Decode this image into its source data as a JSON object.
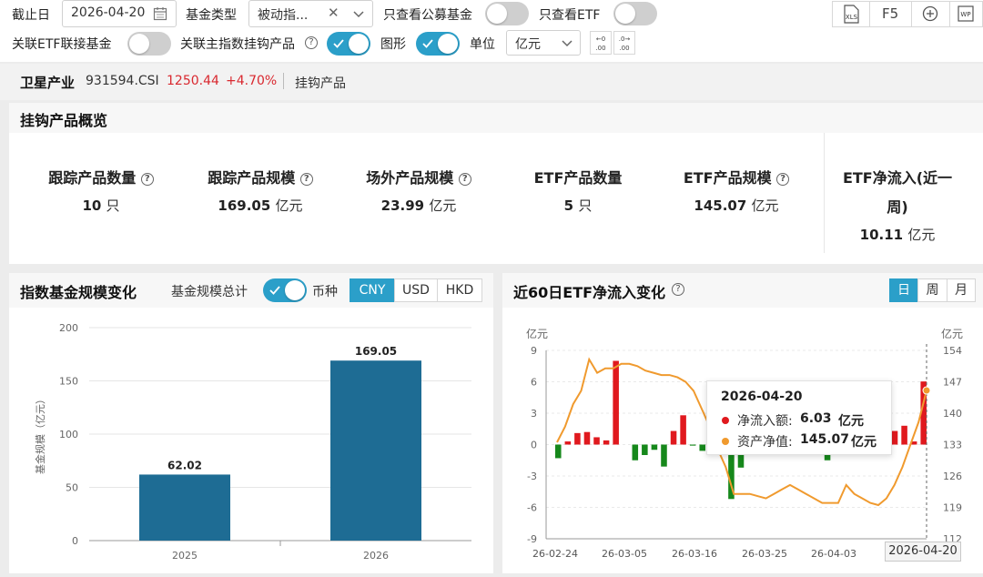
{
  "toolbar": {
    "date_label": "截止日",
    "date_value": "2026-04-20",
    "fund_type_label": "基金类型",
    "fund_type_value": "被动指...",
    "only_public_label": "只查看公募基金",
    "only_etf_label": "只查看ETF",
    "linked_etf_label": "关联ETF联接基金",
    "linked_main_label": "关联主指数挂钩产品",
    "graph_label": "图形",
    "unit_label": "单位",
    "unit_value": "亿元",
    "f5_label": "F5",
    "xls_label": "XLS",
    "wp_label": "WP"
  },
  "index": {
    "name": "卫星产业",
    "code": "931594.CSI",
    "price": "1250.44",
    "change": "+4.70%",
    "tag": "挂钩产品"
  },
  "overview": {
    "title": "挂钩产品概览",
    "stats": [
      {
        "label": "跟踪产品数量",
        "value": "10",
        "unit": "只",
        "help": true
      },
      {
        "label": "跟踪产品规模",
        "value": "169.05",
        "unit": "亿元",
        "help": true
      },
      {
        "label": "场外产品规模",
        "value": "23.99",
        "unit": "亿元",
        "help": true
      },
      {
        "label": "ETF产品数量",
        "value": "5",
        "unit": "只",
        "help": false
      },
      {
        "label": "ETF产品规模",
        "value": "145.07",
        "unit": "亿元",
        "help": true
      },
      {
        "label": "ETF净流入(近一",
        "label2": "周)",
        "value": "10.11",
        "unit": "亿元",
        "help": false
      }
    ]
  },
  "scale_panel": {
    "title": "指数基金规模变化",
    "total_toggle_label": "基金规模总计",
    "currency_label": "币种",
    "currencies": [
      "CNY",
      "USD",
      "HKD"
    ],
    "selected_currency": "CNY"
  },
  "flow_panel": {
    "title": "近60日ETF净流入变化",
    "periods": [
      "日",
      "周",
      "月"
    ],
    "selected_period": "日",
    "tooltip": {
      "date": "2026-04-20",
      "flow_label": "净流入额:",
      "flow_value": "6.03",
      "nav_label": "资产净值:",
      "nav_value": "145.07",
      "unit": "亿元"
    },
    "end_date_label": "2026-04-20"
  },
  "colors": {
    "accent": "#2b9fc9",
    "bar_blue": "#1e6c94",
    "up_red": "#e0191e",
    "down_green": "#16881b",
    "nav_orange": "#f09a2e",
    "price_red": "#d9282f"
  },
  "chart_data": [
    {
      "type": "bar",
      "categories": [
        "2025",
        "2026"
      ],
      "values": [
        62.02,
        169.05
      ],
      "ylabel": "基金规模（亿元）",
      "ylim": [
        0,
        200
      ],
      "yticks": [
        0,
        50,
        100,
        150,
        200
      ],
      "grid": true
    },
    {
      "type": "bar",
      "y_unit_left": "亿元",
      "y_unit_right": "亿元",
      "x_tick_labels": [
        "26-02-24",
        "26-03-05",
        "26-03-16",
        "26-03-25",
        "26-04-03"
      ],
      "yticks_left": [
        -9,
        -6,
        -3,
        0,
        3,
        6,
        9
      ],
      "yticks_right": [
        112,
        119,
        126,
        133,
        140,
        147,
        154
      ],
      "ylim_left": [
        -9,
        9
      ],
      "ylim_right": [
        112,
        154
      ],
      "series": [
        {
          "name": "净流入额",
          "axis": "left",
          "values": [
            -1.3,
            0.3,
            1.1,
            1.2,
            0.7,
            0.4,
            8.0,
            null,
            -1.5,
            -1.0,
            -0.5,
            -2.1,
            1.3,
            2.8,
            -0.1,
            -0.6,
            null,
            null,
            -5.2,
            -2.2,
            null,
            -1.0,
            null,
            null,
            null,
            null,
            null,
            null,
            -1.5,
            -1.0,
            null,
            -0.8,
            null,
            null,
            1.5,
            1.3,
            1.8,
            0.3,
            6.03
          ]
        },
        {
          "name": "资产净值",
          "axis": "right",
          "values": [
            133.5,
            137,
            142,
            145,
            152,
            149,
            150,
            150,
            151,
            151,
            150.5,
            149.5,
            149,
            148.5,
            148.5,
            148,
            147,
            145,
            141,
            137,
            132,
            128,
            122,
            122,
            122,
            121.5,
            121,
            122,
            123,
            124,
            123,
            122,
            121,
            120,
            120,
            120,
            124,
            122,
            121,
            120,
            119.5,
            121,
            124,
            128,
            133,
            138,
            145.07
          ]
        }
      ]
    }
  ]
}
